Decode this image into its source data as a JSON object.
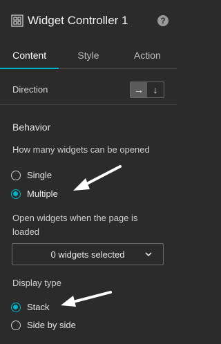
{
  "header": {
    "title": "Widget Controller 1",
    "widget_icon": "grid-icon",
    "help_icon": "help-icon",
    "help_glyph": "?"
  },
  "tabs": [
    {
      "label": "Content",
      "active": true
    },
    {
      "label": "Style",
      "active": false
    },
    {
      "label": "Action",
      "active": false
    }
  ],
  "direction": {
    "label": "Direction",
    "options": [
      {
        "icon": "arrow-right-icon",
        "glyph": "→",
        "selected": true
      },
      {
        "icon": "arrow-down-icon",
        "glyph": "↓",
        "selected": false
      }
    ]
  },
  "behavior": {
    "title": "Behavior",
    "open_question": "How many widgets can be opened",
    "open_options": [
      {
        "label": "Single",
        "checked": false
      },
      {
        "label": "Multiple",
        "checked": true
      }
    ],
    "open_on_load_label": "Open widgets when the page is loaded",
    "select_value": "0 widgets selected",
    "display_type_label": "Display type",
    "display_options": [
      {
        "label": "Stack",
        "checked": true
      },
      {
        "label": "Side by side",
        "checked": false
      }
    ]
  },
  "colors": {
    "accent": "#00b2c8",
    "background": "#2b2b2b"
  }
}
